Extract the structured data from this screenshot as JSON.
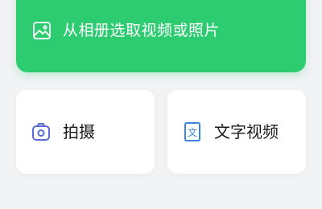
{
  "banner": {
    "label": "从相册选取视频或照片",
    "icon": "image-icon",
    "color": "#2ecc71"
  },
  "cards": [
    {
      "label": "拍摄",
      "icon": "camera-icon",
      "icon_color": "#5b6bd6"
    },
    {
      "label": "文字视频",
      "icon": "text-document-icon",
      "icon_color": "#3a86e0",
      "icon_glyph": "文"
    }
  ]
}
